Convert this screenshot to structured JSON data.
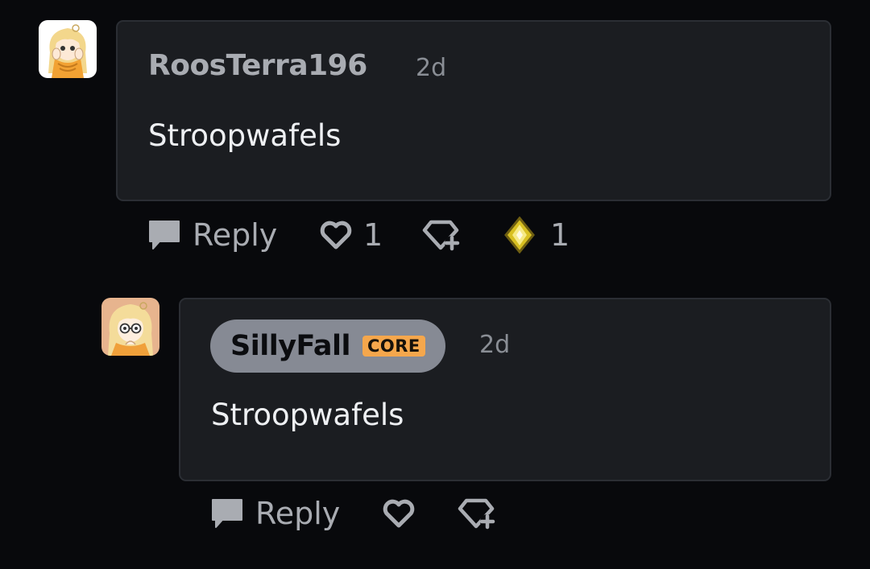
{
  "comments": [
    {
      "author": "RoosTerra196",
      "timestamp": "2d",
      "text": "Stroopwafels",
      "reply_label": "Reply",
      "like_count": "1",
      "award_count": "1",
      "avatar_icon": "avatar-roosterra196-icon"
    },
    {
      "author": "SillyFall",
      "badge": "CORE",
      "timestamp": "2d",
      "text": "Stroopwafels",
      "reply_label": "Reply",
      "avatar_icon": "avatar-sillyfall-icon"
    }
  ],
  "colors": {
    "background": "#08090c",
    "bubble": "#1b1d21",
    "bubble_border": "#2b2e34",
    "muted": "#a9acb2",
    "author_pill": "#868a94",
    "core_badge": "#f5a74c",
    "award": "#d8c022"
  }
}
